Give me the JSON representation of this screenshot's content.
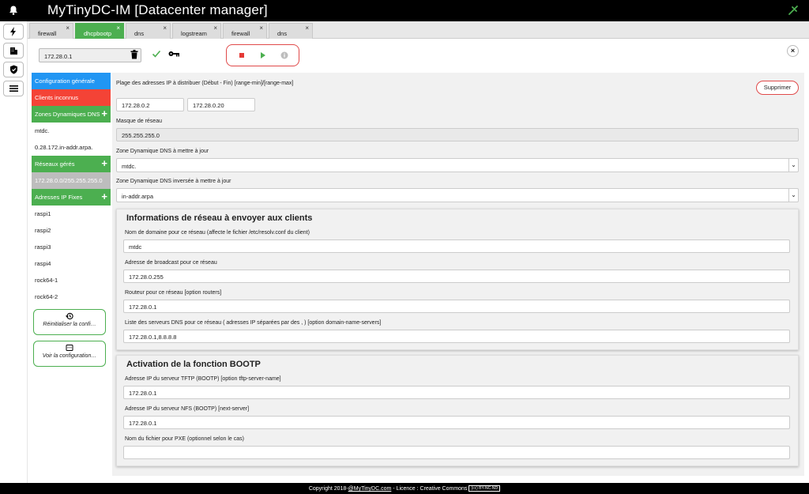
{
  "app": {
    "title": "MyTinyDC-IM [Datacenter manager]"
  },
  "tabs": [
    {
      "label": "firewall",
      "close": "×"
    },
    {
      "label": "dhcpbootp",
      "close": "×"
    },
    {
      "label": "dns",
      "close": "×"
    },
    {
      "label": "logstream",
      "close": "×"
    },
    {
      "label": "firewall",
      "close": "×"
    },
    {
      "label": "dns",
      "close": "×"
    }
  ],
  "toolbar": {
    "selected_ip": "172.28.0.1",
    "close": "×"
  },
  "sidebar": {
    "items": [
      {
        "label": "Configuration générale"
      },
      {
        "label": "Clients inconnus"
      },
      {
        "label": "Zones Dynamiques DNS",
        "plus": "+"
      },
      {
        "label": "mtdc."
      },
      {
        "label": "0.28.172.in-addr.arpa."
      },
      {
        "label": "Réseaux gérés",
        "plus": "+"
      },
      {
        "label": "172.28.0.0/255.255.255.0"
      },
      {
        "label": "Adresses IP Fixes",
        "plus": "+"
      },
      {
        "label": "raspi1"
      },
      {
        "label": "raspi2"
      },
      {
        "label": "raspi3"
      },
      {
        "label": "raspi4"
      },
      {
        "label": "rock64-1"
      },
      {
        "label": "rock64-2"
      }
    ],
    "reset_label": "Réinitialiser la confi…",
    "view_label": "Voir la configuration…"
  },
  "main": {
    "range_label": "Plage des adresses IP à distribuer (Début - Fin) [range-min]/[range-max]",
    "range_min": "172.28.0.2",
    "range_max": "172.28.0.20",
    "delete_label": "Supprimer",
    "netmask_label": "Masque de réseau",
    "netmask_value": "255.255.255.0",
    "dns_zone_label": "Zone Dynamique DNS à mettre à jour",
    "dns_zone_value": "mtdc.",
    "rev_zone_label": "Zone Dynamique DNS inversée à mettre à jour",
    "rev_zone_value": "in-addr.arpa",
    "arrow": "⌄"
  },
  "netinfo": {
    "title": "Informations de réseau à envoyer aux clients",
    "domain_label": "Nom de domaine pour ce réseau (affecte le fichier /etc/resolv.conf du client)",
    "domain_value": "mtdc",
    "broadcast_label": "Adresse de broadcast pour ce réseau",
    "broadcast_value": "172.28.0.255",
    "router_label": "Routeur pour ce réseau [option routers]",
    "router_value": "172.28.0.1",
    "dns_label": "Liste des serveurs DNS pour ce réseau ( adresses IP séparées par des , ) [option domain-name-servers]",
    "dns_value": "172.28.0.1,8.8.8.8"
  },
  "bootp": {
    "title": "Activation de la fonction BOOTP",
    "tftp_label": "Adresse IP du serveur TFTP (BOOTP) [option tftp-server-name]",
    "tftp_value": "172.28.0.1",
    "nfs_label": "Adresse IP du serveur NFS (BOOTP) [next-server]",
    "nfs_value": "172.28.0.1",
    "pxe_label": "Nom du fichier pour PXE (optionnel selon le cas)",
    "pxe_value": ""
  },
  "footer": {
    "prefix": "Copyright 2018-",
    "link": "@MyTinyDC.com",
    "licence": " - Licence : Creative Commons",
    "badge": "(cc) BY-NC-ND"
  },
  "colors": {
    "blue": "#2196f3",
    "red": "#f44336",
    "green": "#4caf50",
    "grey": "#bdbdbd"
  }
}
